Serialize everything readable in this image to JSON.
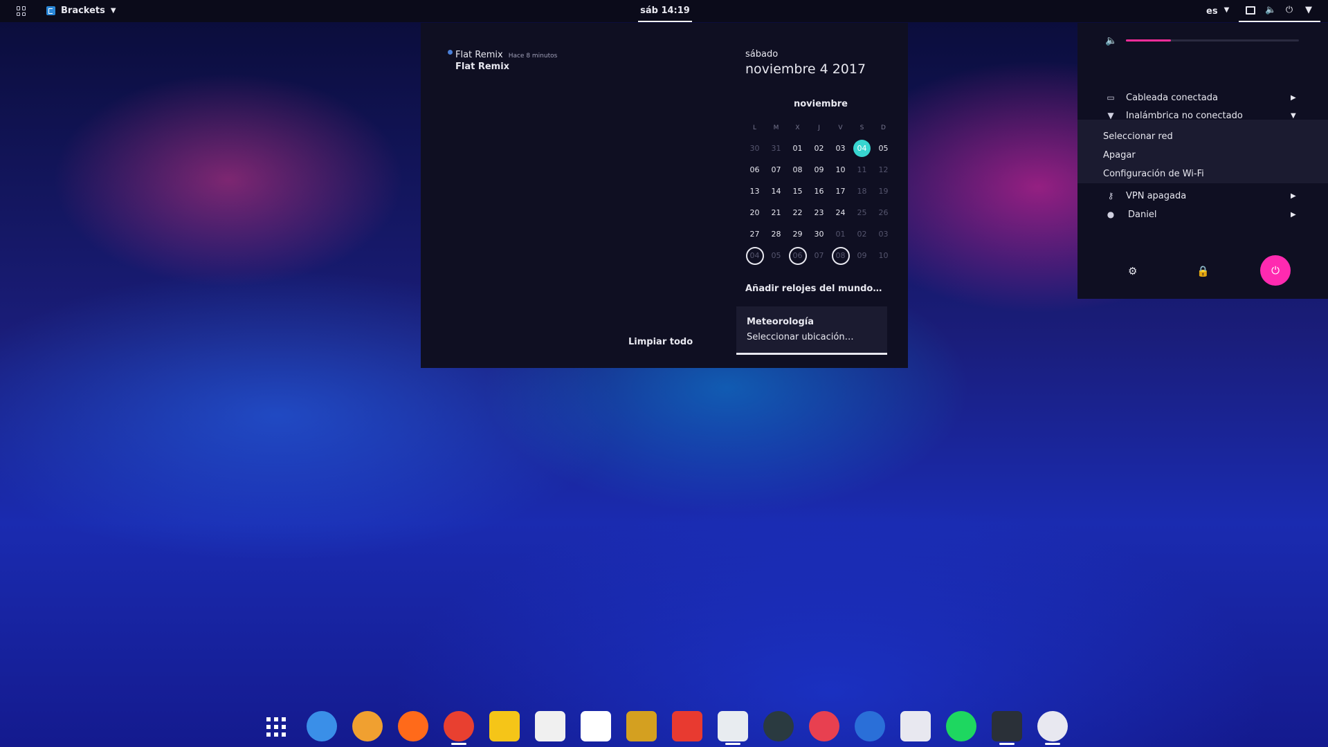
{
  "topbar": {
    "app_name": "Brackets",
    "clock": "sáb 14:19",
    "language": "es"
  },
  "calendar": {
    "notification": {
      "title": "Flat Remix",
      "time": "Hace 8 minutos",
      "body": "Flat Remix"
    },
    "clear_all": "Limpiar todo",
    "weekday_long": "sábado",
    "full_date": "noviembre  4 2017",
    "month": "noviembre",
    "weekdays": [
      "L",
      "M",
      "X",
      "J",
      "V",
      "S",
      "D"
    ],
    "weeks": [
      [
        {
          "d": "30",
          "o": true
        },
        {
          "d": "31",
          "o": true
        },
        {
          "d": "01"
        },
        {
          "d": "02"
        },
        {
          "d": "03"
        },
        {
          "d": "04",
          "today": true
        },
        {
          "d": "05"
        }
      ],
      [
        {
          "d": "06"
        },
        {
          "d": "07"
        },
        {
          "d": "08"
        },
        {
          "d": "09"
        },
        {
          "d": "10"
        },
        {
          "d": "11",
          "o": true
        },
        {
          "d": "12",
          "o": true
        }
      ],
      [
        {
          "d": "13"
        },
        {
          "d": "14"
        },
        {
          "d": "15"
        },
        {
          "d": "16"
        },
        {
          "d": "17"
        },
        {
          "d": "18",
          "o": true
        },
        {
          "d": "19",
          "o": true
        }
      ],
      [
        {
          "d": "20"
        },
        {
          "d": "21"
        },
        {
          "d": "22"
        },
        {
          "d": "23"
        },
        {
          "d": "24"
        },
        {
          "d": "25",
          "o": true
        },
        {
          "d": "26",
          "o": true
        }
      ],
      [
        {
          "d": "27"
        },
        {
          "d": "28"
        },
        {
          "d": "29"
        },
        {
          "d": "30"
        },
        {
          "d": "01",
          "o": true
        },
        {
          "d": "02",
          "o": true
        },
        {
          "d": "03",
          "o": true
        }
      ],
      [
        {
          "d": "04",
          "o": true,
          "ev": true
        },
        {
          "d": "05",
          "o": true
        },
        {
          "d": "06",
          "o": true,
          "ev": true
        },
        {
          "d": "07",
          "o": true
        },
        {
          "d": "08",
          "o": true,
          "ev": true
        },
        {
          "d": "09",
          "o": true
        },
        {
          "d": "10",
          "o": true
        }
      ]
    ],
    "world_clocks": "Añadir relojes del mundo…",
    "weather_title": "Meteorología",
    "weather_location": "Seleccionar ubicación…"
  },
  "system_menu": {
    "volume_level": 0.26,
    "wired": "Cableada conectada",
    "wireless": "Inalámbrica no conectado",
    "wifi_submenu": [
      "Seleccionar red",
      "Apagar",
      "Configuración de Wi-Fi"
    ],
    "vpn": "VPN apagada",
    "user": "Daniel"
  },
  "dock": {
    "apps": [
      {
        "name": "app-grid",
        "color": "#ffffff"
      },
      {
        "name": "settings",
        "color": "#3a8fe8"
      },
      {
        "name": "photos",
        "color": "#f0a030"
      },
      {
        "name": "firefox",
        "color": "#ff6a1a"
      },
      {
        "name": "chrome",
        "color": "#e84030"
      },
      {
        "name": "bulb",
        "color": "#f5c518"
      },
      {
        "name": "mail",
        "color": "#f0f0f0"
      },
      {
        "name": "text-editor",
        "color": "#ffffff"
      },
      {
        "name": "robot",
        "color": "#d4a020"
      },
      {
        "name": "filezilla",
        "color": "#e83a30"
      },
      {
        "name": "files",
        "color": "#e8ecf0"
      },
      {
        "name": "music",
        "color": "#2a3a40"
      },
      {
        "name": "ubuntu-tweak",
        "color": "#e84050"
      },
      {
        "name": "system-monitor",
        "color": "#2a6fd8"
      },
      {
        "name": "installer",
        "color": "#e8e8f0"
      },
      {
        "name": "spotify",
        "color": "#1ed760"
      },
      {
        "name": "terminal",
        "color": "#2a3038"
      },
      {
        "name": "kodi",
        "color": "#e8e8f0"
      }
    ]
  }
}
